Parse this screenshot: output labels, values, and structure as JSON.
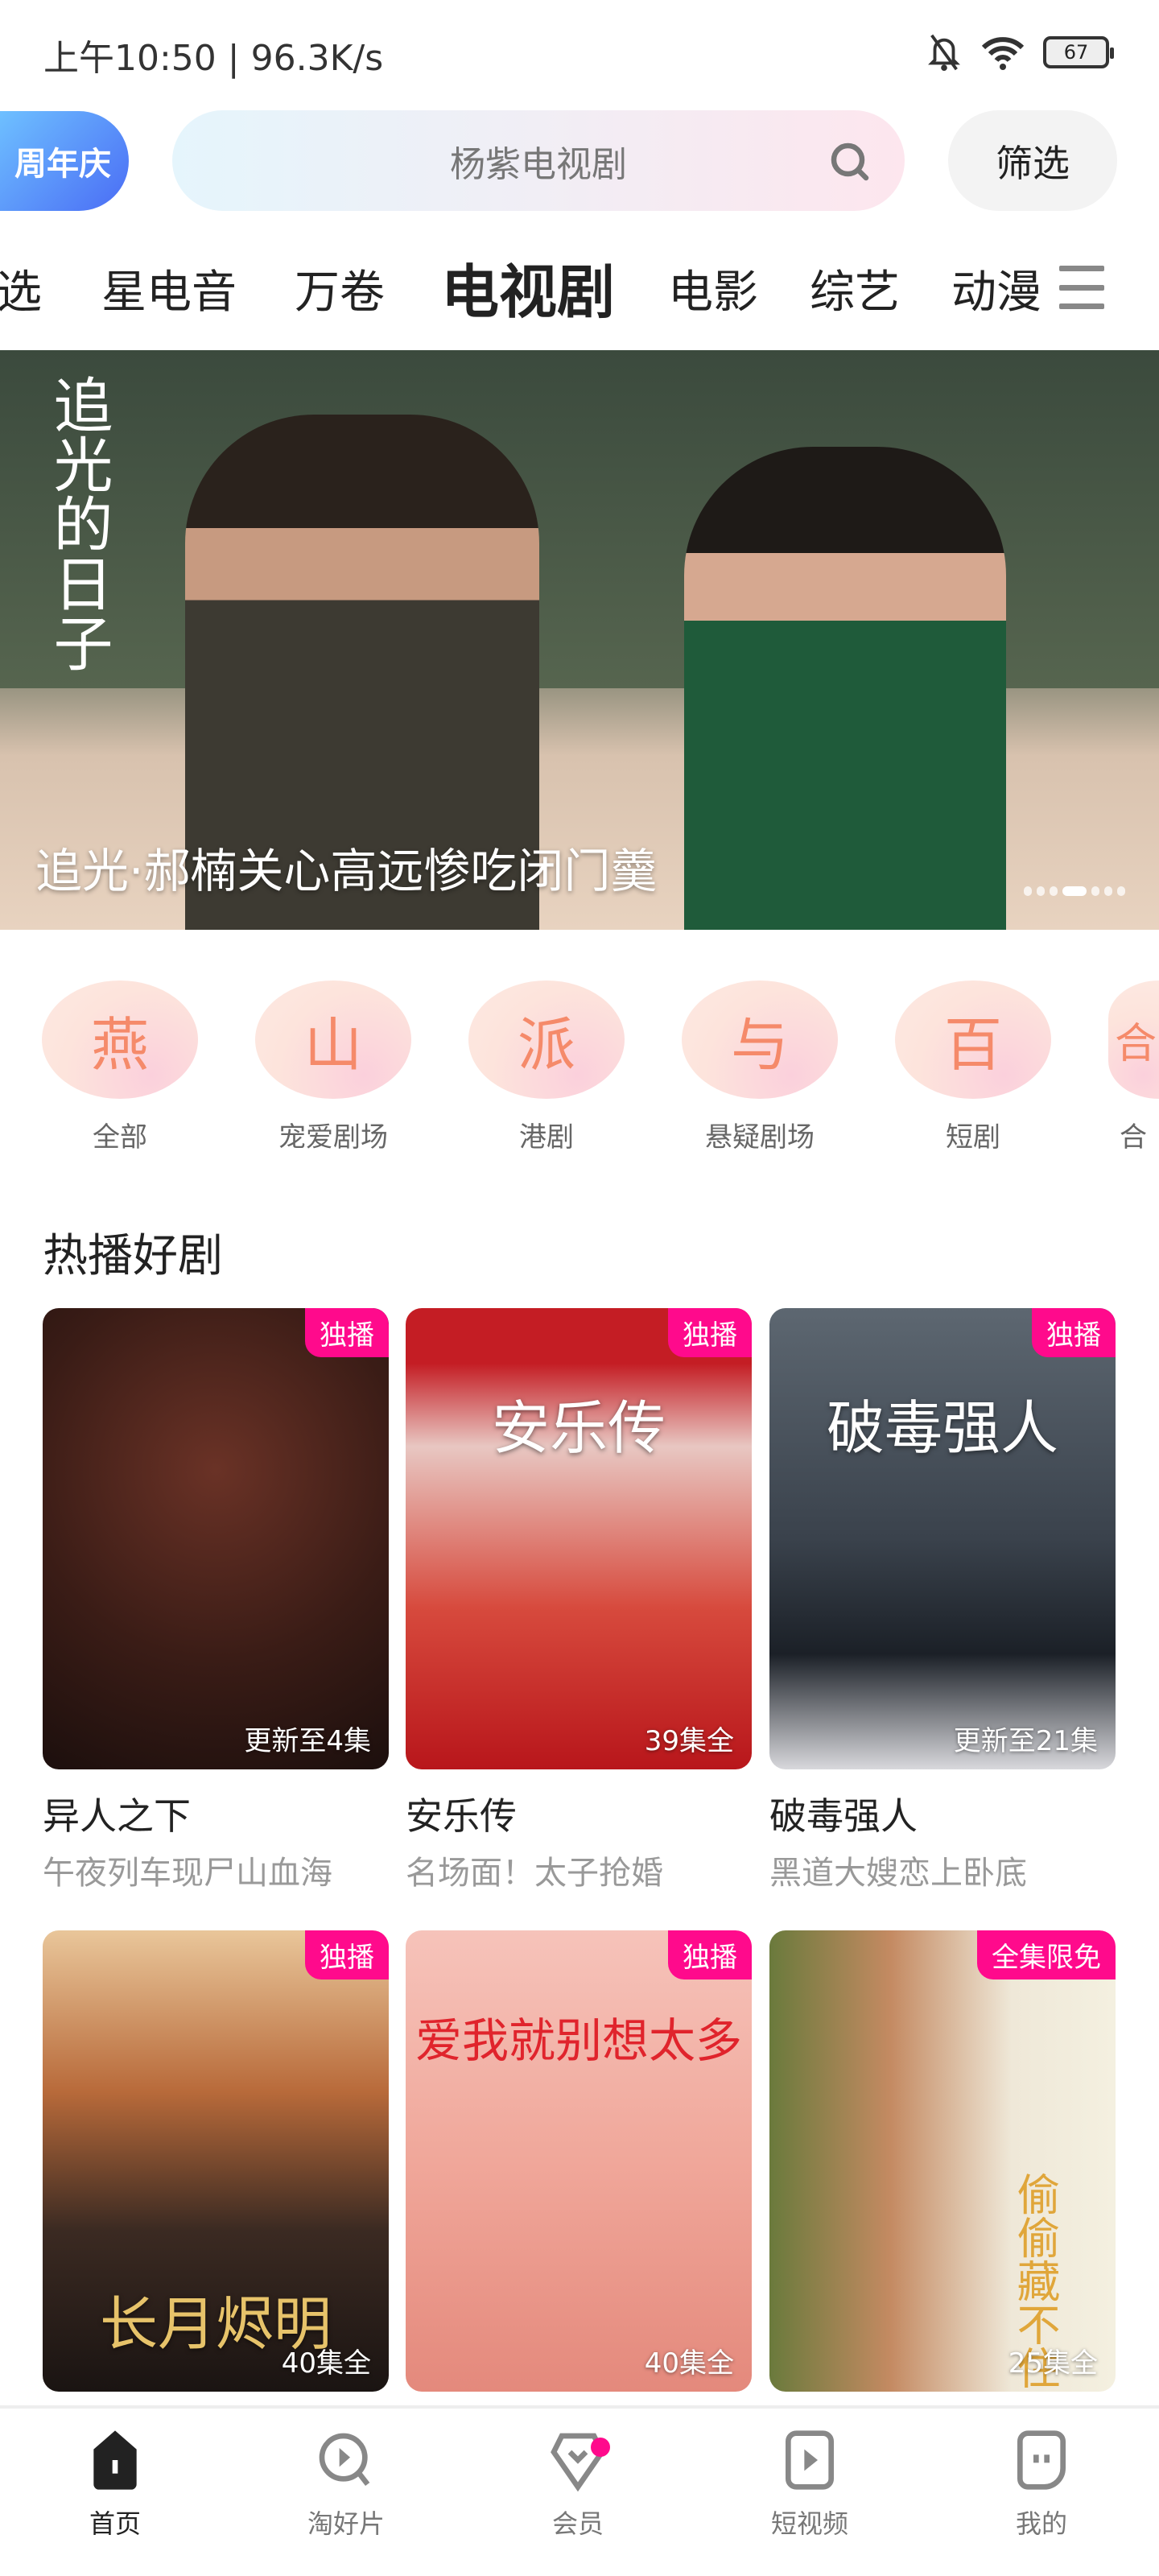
{
  "status_bar": {
    "time": "上午10:50 | 96.3K/s",
    "battery": "67"
  },
  "header": {
    "anniversary_badge": "周年庆",
    "search_placeholder": "杨紫电视剧",
    "filter_label": "筛选"
  },
  "tabs": [
    {
      "label": "精选"
    },
    {
      "label": "星电音"
    },
    {
      "label": "万卷"
    },
    {
      "label": "电视剧",
      "active": true
    },
    {
      "label": "电影"
    },
    {
      "label": "综艺"
    },
    {
      "label": "动漫"
    }
  ],
  "banner": {
    "logo_text": "追光的日子",
    "caption": "追光·郝楠关心高远惨吃闭门羹",
    "slide_count": 7,
    "active_slide": 4
  },
  "categories": [
    {
      "glyph": "燕",
      "label": "全部"
    },
    {
      "glyph": "山",
      "label": "宠爱剧场"
    },
    {
      "glyph": "派",
      "label": "港剧"
    },
    {
      "glyph": "与",
      "label": "悬疑剧场"
    },
    {
      "glyph": "百",
      "label": "短剧"
    },
    {
      "glyph": "合",
      "label": "合"
    }
  ],
  "section": {
    "title": "热播好剧"
  },
  "shows": [
    {
      "title": "异人之下",
      "subtitle": "午夜列车现尸山血海",
      "badge": "独播",
      "episodes": "更新至4集",
      "poster_title": ""
    },
    {
      "title": "安乐传",
      "subtitle": "名场面！太子抢婚",
      "badge": "独播",
      "episodes": "39集全",
      "poster_title": "安乐传"
    },
    {
      "title": "破毒强人",
      "subtitle": "黑道大嫂恋上卧底",
      "badge": "独播",
      "episodes": "更新至21集",
      "poster_title": "破毒强人"
    },
    {
      "badge": "独播",
      "episodes": "40集全",
      "poster_title": "长月烬明"
    },
    {
      "badge": "独播",
      "episodes": "40集全",
      "poster_title": "爱我就别想太多"
    },
    {
      "badge": "全集限免",
      "episodes": "25集全",
      "poster_title": "偷偷藏不住"
    }
  ],
  "bottom_nav": [
    {
      "label": "首页",
      "active": true
    },
    {
      "label": "淘好片"
    },
    {
      "label": "会员"
    },
    {
      "label": "短视频"
    },
    {
      "label": "我的"
    }
  ],
  "colors": {
    "accent": "#ff0a8c",
    "badge_blue": "#4a6cf5"
  }
}
